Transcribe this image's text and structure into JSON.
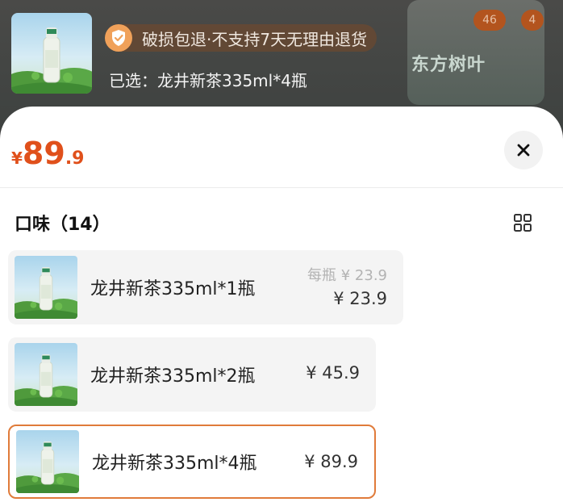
{
  "background": {
    "bottle_label": "东方树叶",
    "badges": [
      "46",
      "4"
    ]
  },
  "header": {
    "notice": "破损包退·不支持7天无理由退货",
    "selected": "已选：龙井新茶335ml*4瓶"
  },
  "sheet": {
    "price": {
      "currency": "¥",
      "integer": "89",
      "decimal": ".9"
    },
    "section_title": "口味（14）",
    "options": [
      {
        "name": "龙井新茶335ml*1瓶",
        "unit_price": "每瓶 ¥ 23.9",
        "price": "¥ 23.9",
        "selected": false
      },
      {
        "name": "龙井新茶335ml*2瓶",
        "price": "¥ 45.9",
        "selected": false
      },
      {
        "name": "龙井新茶335ml*4瓶",
        "price": "¥ 89.9",
        "selected": true
      }
    ]
  },
  "colors": {
    "accent": "#e0501b",
    "selected_border": "#e07b3a",
    "option_bg": "#f4f4f4"
  },
  "icons": {
    "close": "close-icon",
    "grid": "grid-view-icon",
    "shield": "shield-check-icon"
  }
}
